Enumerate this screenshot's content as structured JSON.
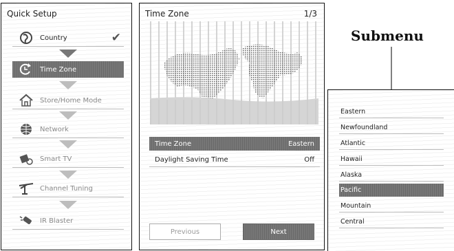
{
  "quick_setup": {
    "title": "Quick Setup",
    "steps": [
      {
        "label": "Country",
        "icon": "globe-icon",
        "done": true
      },
      {
        "label": "Time Zone",
        "icon": "clock-arrow-icon",
        "active": true
      },
      {
        "label": "Store/Home Mode",
        "icon": "home-icon"
      },
      {
        "label": "Network",
        "icon": "network-globe-icon"
      },
      {
        "label": "Smart TV",
        "icon": "smart-tv-icon"
      },
      {
        "label": "Channel Tuning",
        "icon": "antenna-icon"
      },
      {
        "label": "IR Blaster",
        "icon": "ir-blaster-icon"
      }
    ]
  },
  "time_zone": {
    "title": "Time Zone",
    "page": "1/3",
    "settings": [
      {
        "label": "Time Zone",
        "value": "Eastern",
        "selected": true
      },
      {
        "label": "Daylight Saving Time",
        "value": "Off"
      }
    ],
    "previous_label": "Previous",
    "next_label": "Next"
  },
  "callout": {
    "label": "Submenu"
  },
  "submenu": {
    "items": [
      {
        "label": "Eastern"
      },
      {
        "label": "Newfoundland"
      },
      {
        "label": "Atlantic"
      },
      {
        "label": "Hawaii"
      },
      {
        "label": "Alaska"
      },
      {
        "label": "Pacific",
        "selected": true
      },
      {
        "label": "Mountain"
      },
      {
        "label": "Central"
      }
    ]
  },
  "colors": {
    "highlight": "#777777",
    "border": "#111111",
    "divider": "#bbbbbb"
  }
}
